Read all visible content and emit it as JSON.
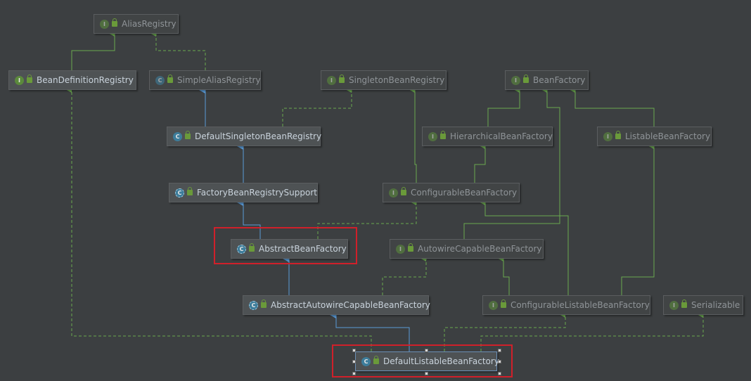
{
  "diagram": {
    "nodes": {
      "alias_registry": {
        "label": "AliasRegistry",
        "kind": "interface"
      },
      "bean_definition_registry": {
        "label": "BeanDefinitionRegistry",
        "kind": "interface"
      },
      "simple_alias_registry": {
        "label": "SimpleAliasRegistry",
        "kind": "class"
      },
      "singleton_bean_registry": {
        "label": "SingletonBeanRegistry",
        "kind": "interface"
      },
      "bean_factory": {
        "label": "BeanFactory",
        "kind": "interface"
      },
      "default_singleton_bean_registry": {
        "label": "DefaultSingletonBeanRegistry",
        "kind": "class"
      },
      "hierarchical_bean_factory": {
        "label": "HierarchicalBeanFactory",
        "kind": "interface"
      },
      "listable_bean_factory": {
        "label": "ListableBeanFactory",
        "kind": "interface"
      },
      "factory_bean_registry_support": {
        "label": "FactoryBeanRegistrySupport",
        "kind": "abstract-class"
      },
      "configurable_bean_factory": {
        "label": "ConfigurableBeanFactory",
        "kind": "interface"
      },
      "abstract_bean_factory": {
        "label": "AbstractBeanFactory",
        "kind": "abstract-class"
      },
      "autowire_capable_bean_factory": {
        "label": "AutowireCapableBeanFactory",
        "kind": "interface"
      },
      "abstract_autowire_capable_bean_factory": {
        "label": "AbstractAutowireCapableBeanFactory",
        "kind": "abstract-class"
      },
      "configurable_listable_bean_factory": {
        "label": "ConfigurableListableBeanFactory",
        "kind": "interface"
      },
      "serializable": {
        "label": "Serializable",
        "kind": "interface"
      },
      "default_listable_bean_factory": {
        "label": "DefaultListableBeanFactory",
        "kind": "class"
      }
    },
    "badge_letters": {
      "interface": "I",
      "class": "C",
      "abstract-class": "C"
    },
    "highlighted": [
      "abstract_bean_factory",
      "default_listable_bean_factory"
    ],
    "colors": {
      "background": "#3c3f41",
      "extends_arrow": "#5a9bd8",
      "implements_arrow": "#6aa84f",
      "highlight_box": "#d0202a"
    }
  }
}
